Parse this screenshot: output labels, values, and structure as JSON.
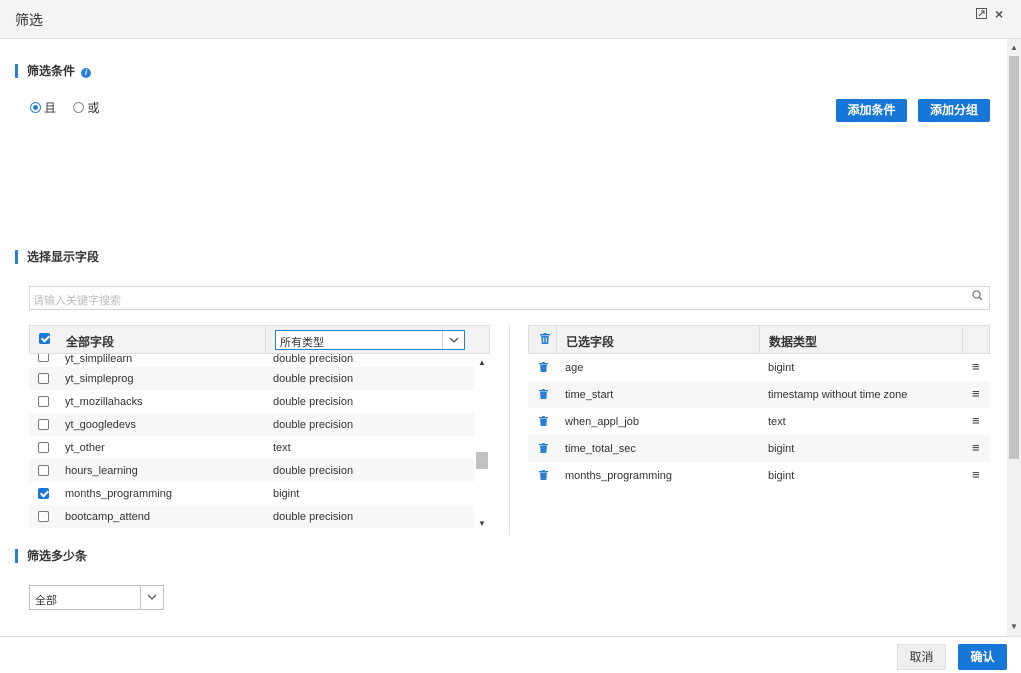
{
  "dialog": {
    "title": "筛选"
  },
  "filter_section": {
    "title": "筛选条件",
    "radio_and": "且",
    "radio_or": "或",
    "selected": "且",
    "add_condition": "添加条件",
    "add_group": "添加分组"
  },
  "fields_section": {
    "title": "选择显示字段",
    "search_placeholder": "请输入关键字搜索"
  },
  "left_grid": {
    "header_all": "全部字段",
    "type_filter": "所有类型",
    "rows": [
      {
        "name": "yt_simplilearn",
        "type": "double precision",
        "checked": false
      },
      {
        "name": "yt_simpleprog",
        "type": "double precision",
        "checked": false
      },
      {
        "name": "yt_mozillahacks",
        "type": "double precision",
        "checked": false
      },
      {
        "name": "yt_googledevs",
        "type": "double precision",
        "checked": false
      },
      {
        "name": "yt_other",
        "type": "text",
        "checked": false
      },
      {
        "name": "hours_learning",
        "type": "double precision",
        "checked": false
      },
      {
        "name": "months_programming",
        "type": "bigint",
        "checked": true
      },
      {
        "name": "bootcamp_attend",
        "type": "double precision",
        "checked": false
      }
    ]
  },
  "right_grid": {
    "header_selected": "已选字段",
    "header_type": "数据类型",
    "rows": [
      {
        "name": "age",
        "type": "bigint"
      },
      {
        "name": "time_start",
        "type": "timestamp without time zone"
      },
      {
        "name": "when_appl_job",
        "type": "text"
      },
      {
        "name": "time_total_sec",
        "type": "bigint"
      },
      {
        "name": "months_programming",
        "type": "bigint"
      }
    ]
  },
  "count_section": {
    "title": "筛选多少条",
    "value": "全部"
  },
  "footer": {
    "cancel": "取消",
    "confirm": "确认"
  },
  "colors": {
    "accent": "#1677d9",
    "section_bar": "#2a7fd4"
  },
  "icons": {
    "maximize": "maximize-icon",
    "close": "close-icon",
    "info": "info-icon",
    "search": "search-icon",
    "trash": "trash-icon",
    "drag": "drag-handle-icon",
    "dropdown": "chevron-down-icon"
  }
}
